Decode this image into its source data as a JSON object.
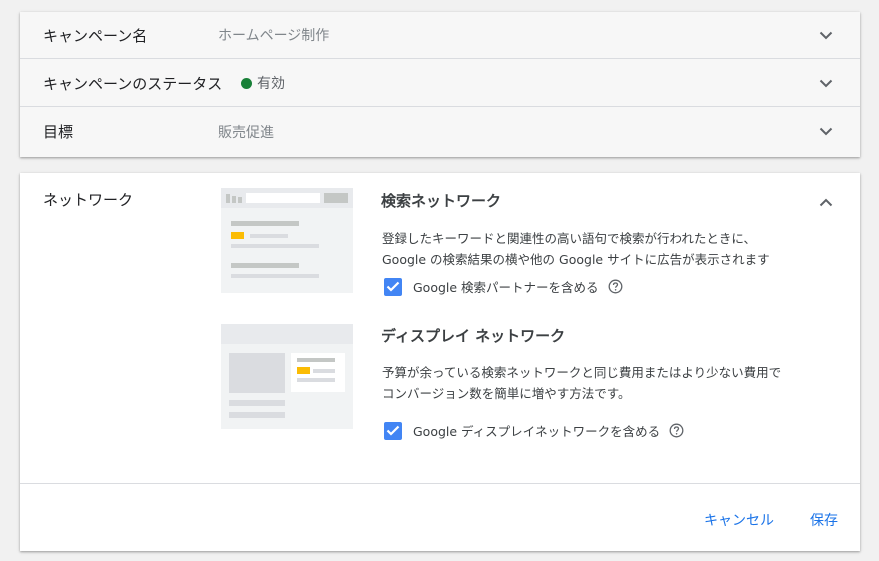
{
  "summary": {
    "rows": [
      {
        "label": "キャンペーン名",
        "value": "ホームページ制作"
      },
      {
        "label": "キャンペーンのステータス",
        "value": "有効",
        "status_color": "#188038"
      },
      {
        "label": "目標",
        "value": "販売促進"
      }
    ]
  },
  "network": {
    "label": "ネットワーク",
    "search": {
      "title": "検索ネットワーク",
      "description": "登録したキーワードと関連性の高い語句で検索が行われたときに、Google の検索結果の横や他の Google サイトに広告が表示されます",
      "checkbox_label": "Google 検索パートナーを含める",
      "checked": true
    },
    "display": {
      "title": "ディスプレイ ネットワーク",
      "description": "予算が余っている検索ネットワークと同じ費用またはより少ない費用でコンバージョン数を簡単に増やす方法です。",
      "checkbox_label": "Google ディスプレイネットワークを含める",
      "checked": true
    }
  },
  "footer": {
    "cancel_label": "キャンセル",
    "save_label": "保存"
  },
  "colors": {
    "accent": "#1a73e8",
    "checkbox": "#4285f4",
    "active_status": "#188038",
    "illustration_highlight": "#fbbc04"
  }
}
